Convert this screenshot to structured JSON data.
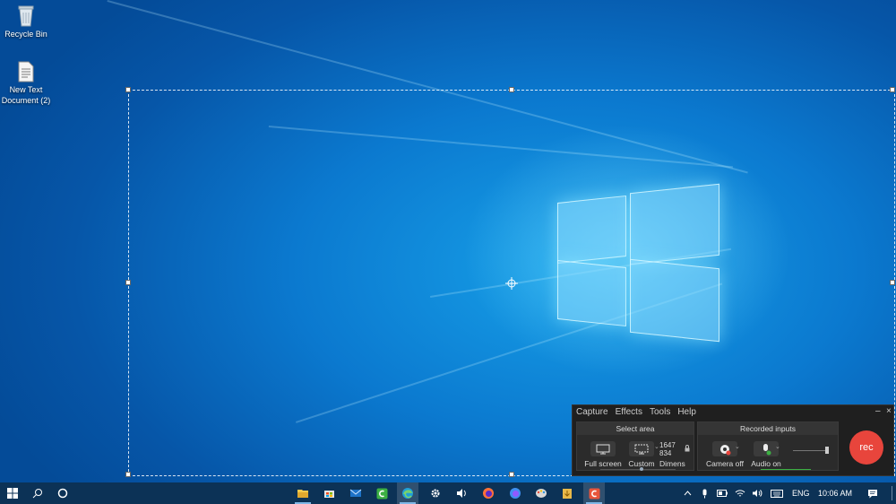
{
  "desktop": {
    "icons": [
      {
        "label": "Recycle Bin",
        "icon": "recycle-bin-icon"
      },
      {
        "label": "New Text Document (2)",
        "icon": "text-file-icon"
      }
    ]
  },
  "recorder": {
    "menu": [
      "Capture",
      "Effects",
      "Tools",
      "Help"
    ],
    "window_controls": {
      "minimize": "–",
      "close": "×"
    },
    "select_area": {
      "title": "Select area",
      "full_screen_label": "Full screen",
      "custom_label": "Custom",
      "width_value": "1647",
      "height_value": "834",
      "dimensions_label": "Dimens"
    },
    "recorded_inputs": {
      "title": "Recorded inputs",
      "camera_label": "Camera off",
      "audio_label": "Audio on"
    },
    "rec_label": "rec",
    "colors": {
      "rec": "#e8453c",
      "panel": "#2b2b2b"
    }
  },
  "taskbar": {
    "apps": [
      "file-explorer-icon",
      "store-icon",
      "mail-icon",
      "camtasia-icon",
      "edge-icon",
      "settings-icon",
      "volume-app-icon",
      "firefox-icon",
      "firefox-dev-icon",
      "paint-icon",
      "install-icon",
      "snagit-icon"
    ],
    "language": "ENG",
    "time": "10:06 AM"
  }
}
